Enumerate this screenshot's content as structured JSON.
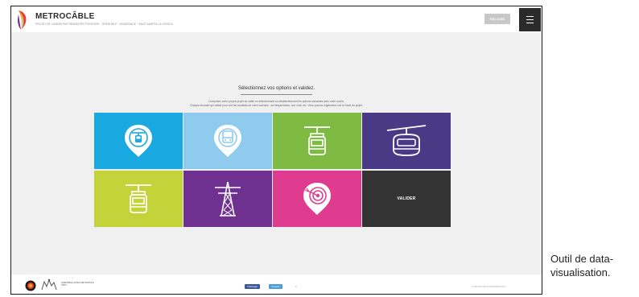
{
  "header": {
    "brand": "METROCÂBLE",
    "tagline": "PROJET DE LIAISON PAR REMONTÉE POINTOISE · GRENOBLE · SASSENAGE · SAINT-MARTIN-LE-VINOUX",
    "login_label": "RELOGIN",
    "menu_icon": "hamburger-menu-icon"
  },
  "main": {
    "heading": "Sélectionnez vos options et validez.",
    "intro_lines": [
      "Composez votre propre projet du câble en sélectionnant ou désélectionnant les options suivantes avec votre souris.",
      "Chaque encadré qui validé pour voir les résultats de votre scénario : sa fréquentation, son coût, etc. Vous pourrez également voir le tracé du projet."
    ],
    "tiles": [
      {
        "icon": "station-map-pin-icon",
        "color": "#19a8e0"
      },
      {
        "icon": "bus-map-pin-icon",
        "color": "#8fcbec"
      },
      {
        "icon": "cable-car-cabin-icon",
        "color": "#7fbb42"
      },
      {
        "icon": "gondola-cabin-icon",
        "color": "#4a3a86"
      },
      {
        "icon": "cable-car-cabin-icon",
        "color": "#c3d339"
      },
      {
        "icon": "pylon-icon",
        "color": "#6e3190"
      },
      {
        "icon": "target-map-pin-icon",
        "color": "#e03c8f"
      },
      {
        "label": "VALIDER",
        "color": "#333333"
      }
    ]
  },
  "footer": {
    "partner_text": [
      "GRENOBLE-ALPES MÉTROPOLE",
      "SMTC"
    ],
    "share_facebook": "f Partager",
    "share_twitter": "Tweeter",
    "share_count": "0",
    "rights": "© MÉTROCÂBLE GRENOBLE 2014"
  },
  "caption": "Outil de data-visualisation."
}
